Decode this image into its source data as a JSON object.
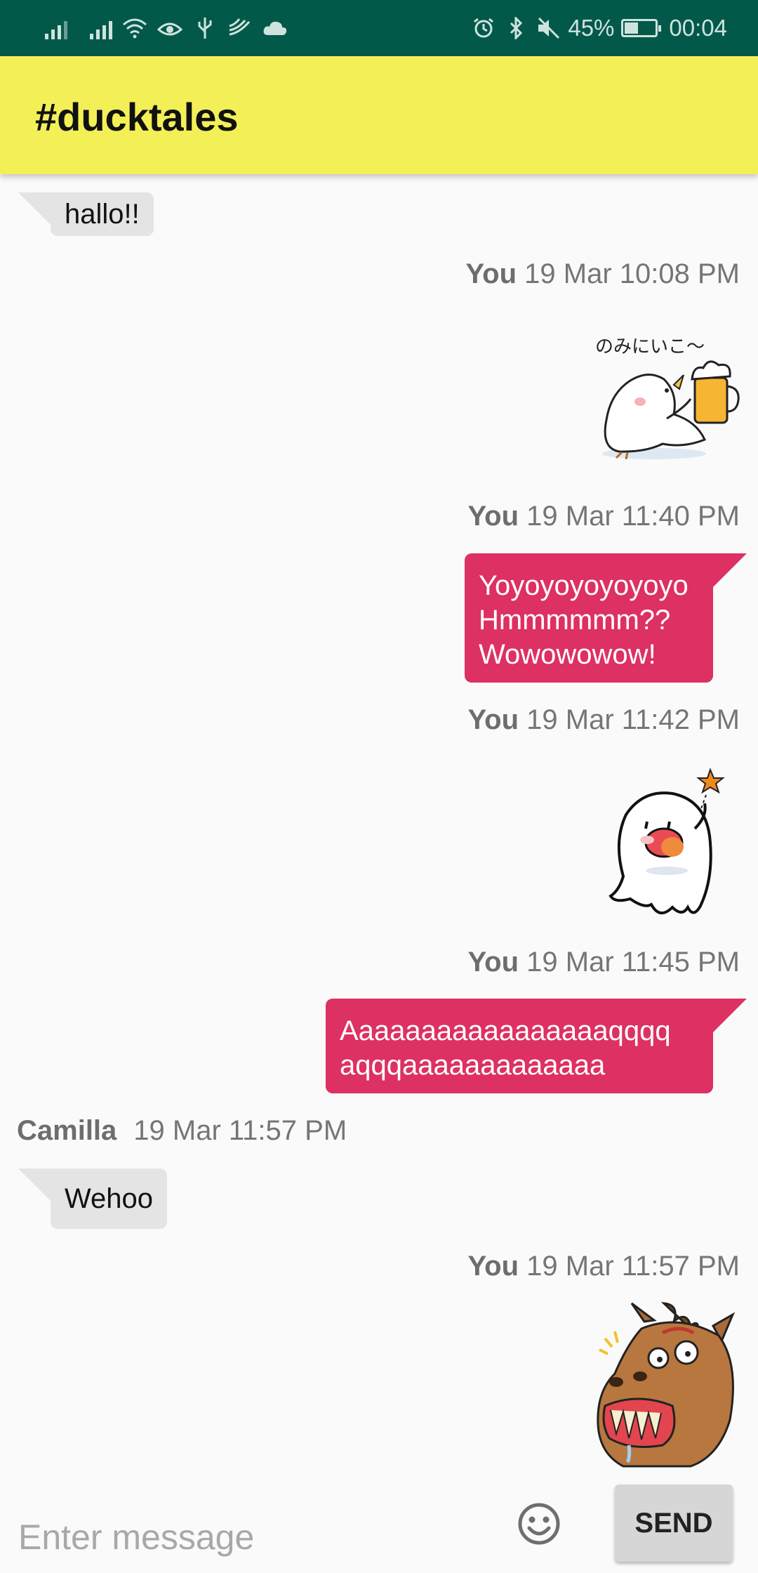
{
  "status_bar": {
    "battery_percent": "45%",
    "battery_level": 0.45,
    "time": "00:04",
    "left_icons": [
      "signal-icon",
      "signal-icon",
      "wifi-icon",
      "eye-icon",
      "usb-icon",
      "cast-icon",
      "cloud-icon"
    ],
    "right_icons": [
      "alarm-icon",
      "bluetooth-icon",
      "mute-icon",
      "battery-icon"
    ]
  },
  "app_bar": {
    "title": "#ducktales"
  },
  "messages": [
    {
      "type": "text",
      "direction": "in",
      "text": "hallo!!"
    },
    {
      "type": "header",
      "sender": "You",
      "timestamp": "19 Mar 10:08 PM"
    },
    {
      "type": "sticker",
      "direction": "out",
      "sticker": "bird-beer-sticker",
      "caption": "のみにいこ〜"
    },
    {
      "type": "header",
      "sender": "You",
      "timestamp": "19 Mar 11:40 PM"
    },
    {
      "type": "text",
      "direction": "out",
      "lines": [
        "Yoyoyoyoyoyoyo",
        "Hmmmmmm??",
        "Wowowowow!"
      ]
    },
    {
      "type": "header",
      "sender": "You",
      "timestamp": "19 Mar 11:42 PM"
    },
    {
      "type": "sticker",
      "direction": "out",
      "sticker": "ghost-tongue-sticker"
    },
    {
      "type": "header",
      "sender": "You",
      "timestamp": "19 Mar 11:45 PM"
    },
    {
      "type": "text",
      "direction": "out",
      "lines": [
        "Aaaaaaaaaaaaaaaaaqqqq",
        "aqqqaaaaaaaaaaaaa"
      ]
    },
    {
      "type": "header",
      "sender": "Camilla",
      "timestamp": "19 Mar 11:57 PM"
    },
    {
      "type": "text",
      "direction": "in",
      "text": "Wehoo"
    },
    {
      "type": "header",
      "sender": "You",
      "timestamp": "19 Mar 11:57 PM"
    },
    {
      "type": "sticker",
      "direction": "out",
      "sticker": "horse-grin-sticker"
    }
  ],
  "composer": {
    "placeholder": "Enter message",
    "emoji_icon": "emoji-icon",
    "send_label": "SEND"
  },
  "colors": {
    "status_bar": "#02594a",
    "app_bar": "#f3ef57",
    "outgoing_bubble": "#dd3063",
    "incoming_bubble": "#e4e4e4",
    "background": "#fafafa"
  }
}
